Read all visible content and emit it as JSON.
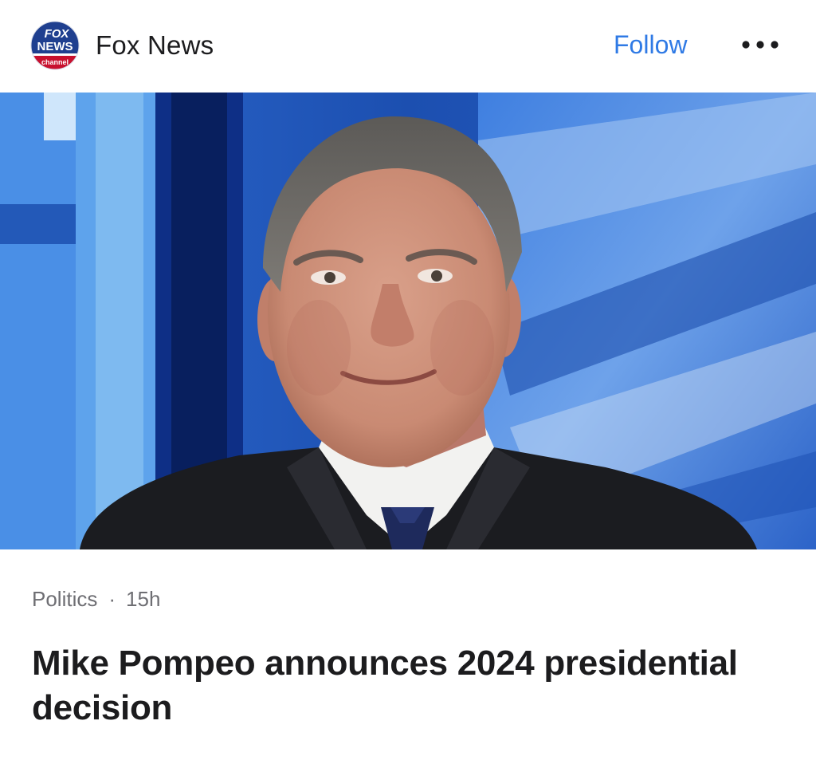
{
  "source": {
    "name": "Fox News",
    "logo_text_top": "FOX",
    "logo_text_middle": "NEWS",
    "logo_text_bottom": "channel"
  },
  "actions": {
    "follow_label": "Follow",
    "more_icon": "ellipsis-icon"
  },
  "article": {
    "category": "Politics",
    "separator": "·",
    "age": "15h",
    "headline": "Mike Pompeo announces 2024 presidential decision"
  },
  "colors": {
    "accent": "#2f7ae5",
    "text_primary": "#1c1c1e",
    "text_secondary": "#6e6e73",
    "logo_blue": "#1f3f8f",
    "logo_red": "#c8102e"
  }
}
